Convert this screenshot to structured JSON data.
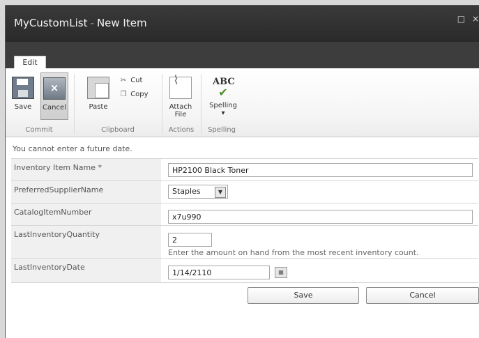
{
  "window": {
    "title": "MyCustomList",
    "separator": "-",
    "subtitle": "New Item",
    "controls": {
      "maximize": "□",
      "close": "×"
    }
  },
  "tabs": [
    {
      "label": "Edit"
    }
  ],
  "ribbon": {
    "groups": {
      "commit": {
        "label": "Commit",
        "save": "Save",
        "cancel": "Cancel"
      },
      "clipboard": {
        "label": "Clipboard",
        "paste": "Paste",
        "cut": "Cut",
        "copy": "Copy"
      },
      "actions": {
        "label": "Actions",
        "attach_line1": "Attach",
        "attach_line2": "File"
      },
      "spelling": {
        "label": "Spelling",
        "spelling": "Spelling",
        "abc": "ABC",
        "dropdown": "▾"
      }
    }
  },
  "form": {
    "message": "You cannot enter a future date.",
    "fields": {
      "item_name": {
        "label": "Inventory Item Name *",
        "value": "HP2100 Black Toner"
      },
      "supplier": {
        "label": "PreferredSupplierName",
        "value": "Staples"
      },
      "catalog": {
        "label": "CatalogItemNumber",
        "value": "x7u990"
      },
      "quantity": {
        "label": "LastInventoryQuantity",
        "value": "2",
        "hint": "Enter the amount on hand from the most recent inventory count."
      },
      "date": {
        "label": "LastInventoryDate",
        "value": "1/14/2110"
      }
    },
    "buttons": {
      "save": "Save",
      "cancel": "Cancel"
    }
  },
  "colors": {
    "titlebar": "#2e2e2e",
    "label_bg": "#f0f0f0",
    "check_green": "#4e8e2a"
  }
}
